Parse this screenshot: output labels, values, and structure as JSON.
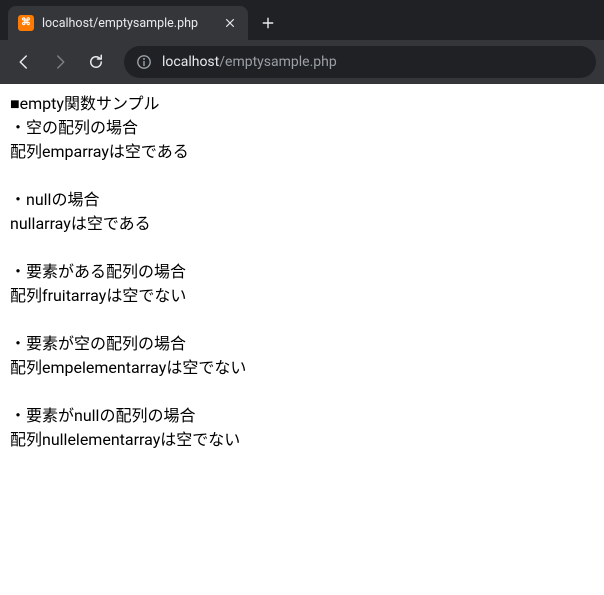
{
  "browser": {
    "tab": {
      "title": "localhost/emptysample.php",
      "favicon_text": "⌘"
    },
    "address": {
      "host": "localhost",
      "path": "/emptysample.php"
    }
  },
  "page": {
    "heading": "■empty関数サンプル",
    "sections": [
      {
        "label": "・空の配列の場合",
        "result": "配列emparrayは空である"
      },
      {
        "label": "・nullの場合",
        "result": "nullarrayは空である"
      },
      {
        "label": "・要素がある配列の場合",
        "result": "配列fruitarrayは空でない"
      },
      {
        "label": "・要素が空の配列の場合",
        "result": "配列empelementarrayは空でない"
      },
      {
        "label": "・要素がnullの配列の場合",
        "result": "配列nullelementarrayは空でない"
      }
    ]
  }
}
